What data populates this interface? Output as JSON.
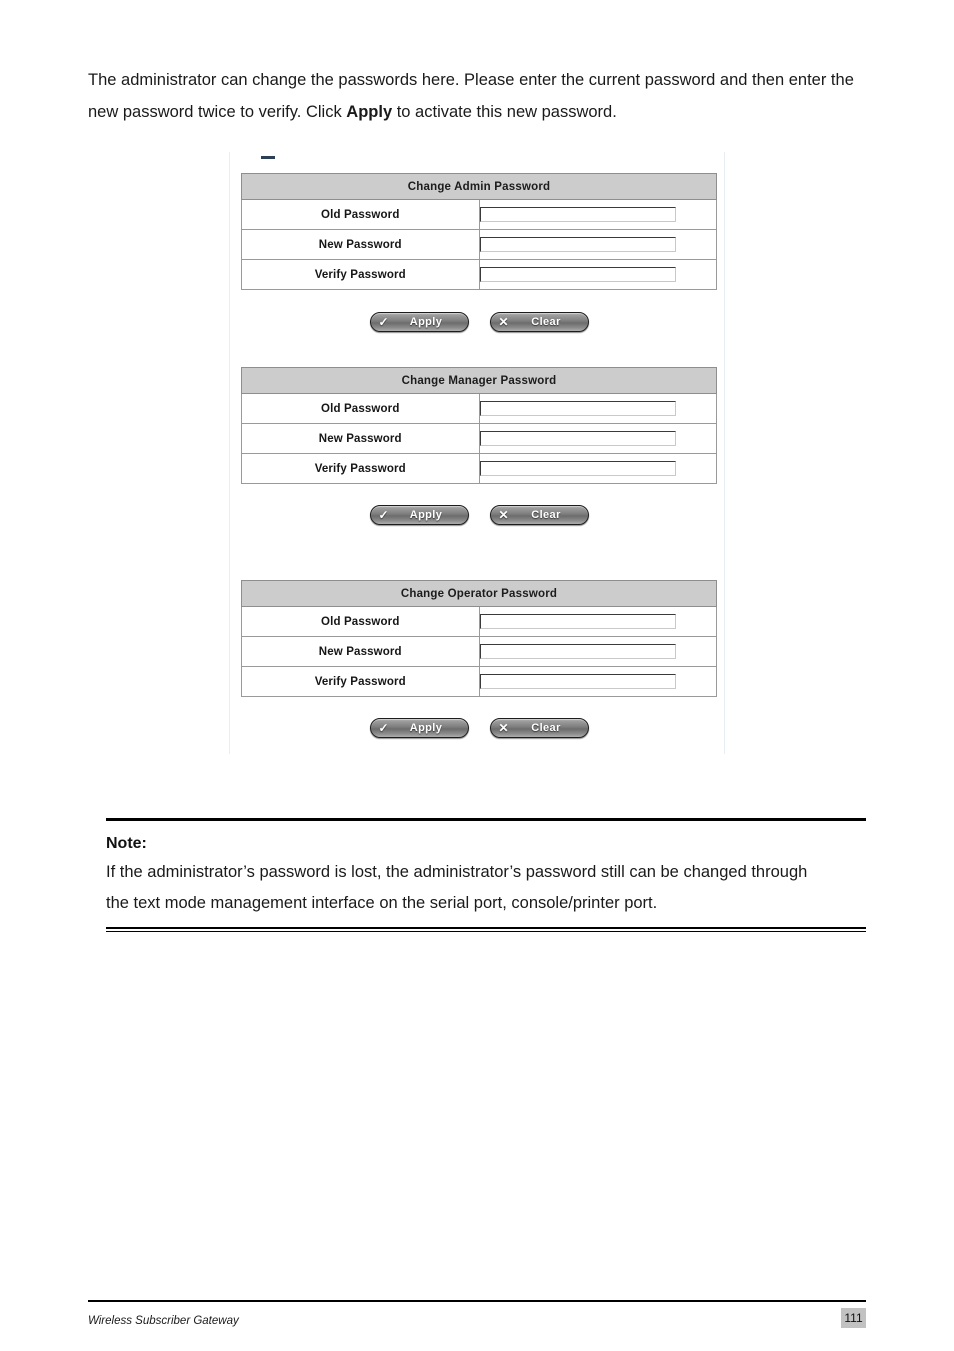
{
  "intro": {
    "part1": "The administrator can change the passwords here. Please enter the current password and then enter the new password twice to verify. Click ",
    "emphasis": "Apply",
    "part2": " to activate this new password."
  },
  "screenshot": {
    "panels": [
      {
        "title": "Change Admin Password",
        "rows": [
          {
            "label": "Old Password",
            "value": ""
          },
          {
            "label": "New Password",
            "value": ""
          },
          {
            "label": "Verify Password",
            "value": ""
          }
        ],
        "buttons": [
          {
            "icon": "check-icon",
            "glyph": "✓",
            "label": "Apply"
          },
          {
            "icon": "cross-icon",
            "glyph": "✕",
            "label": "Clear"
          }
        ]
      },
      {
        "title": "Change Manager Password",
        "rows": [
          {
            "label": "Old Password",
            "value": ""
          },
          {
            "label": "New Password",
            "value": ""
          },
          {
            "label": "Verify Password",
            "value": ""
          }
        ],
        "buttons": [
          {
            "icon": "check-icon",
            "glyph": "✓",
            "label": "Apply"
          },
          {
            "icon": "cross-icon",
            "glyph": "✕",
            "label": "Clear"
          }
        ]
      },
      {
        "title": "Change Operator Password",
        "rows": [
          {
            "label": "Old Password",
            "value": ""
          },
          {
            "label": "New Password",
            "value": ""
          },
          {
            "label": "Verify Password",
            "value": ""
          }
        ],
        "buttons": [
          {
            "icon": "check-icon",
            "glyph": "✓",
            "label": "Apply"
          },
          {
            "icon": "cross-icon",
            "glyph": "✕",
            "label": "Clear"
          }
        ]
      }
    ],
    "colors": {
      "header_bar": "#cccccc",
      "table_border": "#8e8e8e",
      "button_outline": "#1d1d1d"
    }
  },
  "note": {
    "title": "Note:",
    "line1": "If the administrator’s password is lost, the administrator’s password still can be changed through",
    "line2": "the text mode management interface on the serial port, console/printer port."
  },
  "footer": {
    "document_title": "Wireless Subscriber Gateway",
    "page_number": "111"
  }
}
